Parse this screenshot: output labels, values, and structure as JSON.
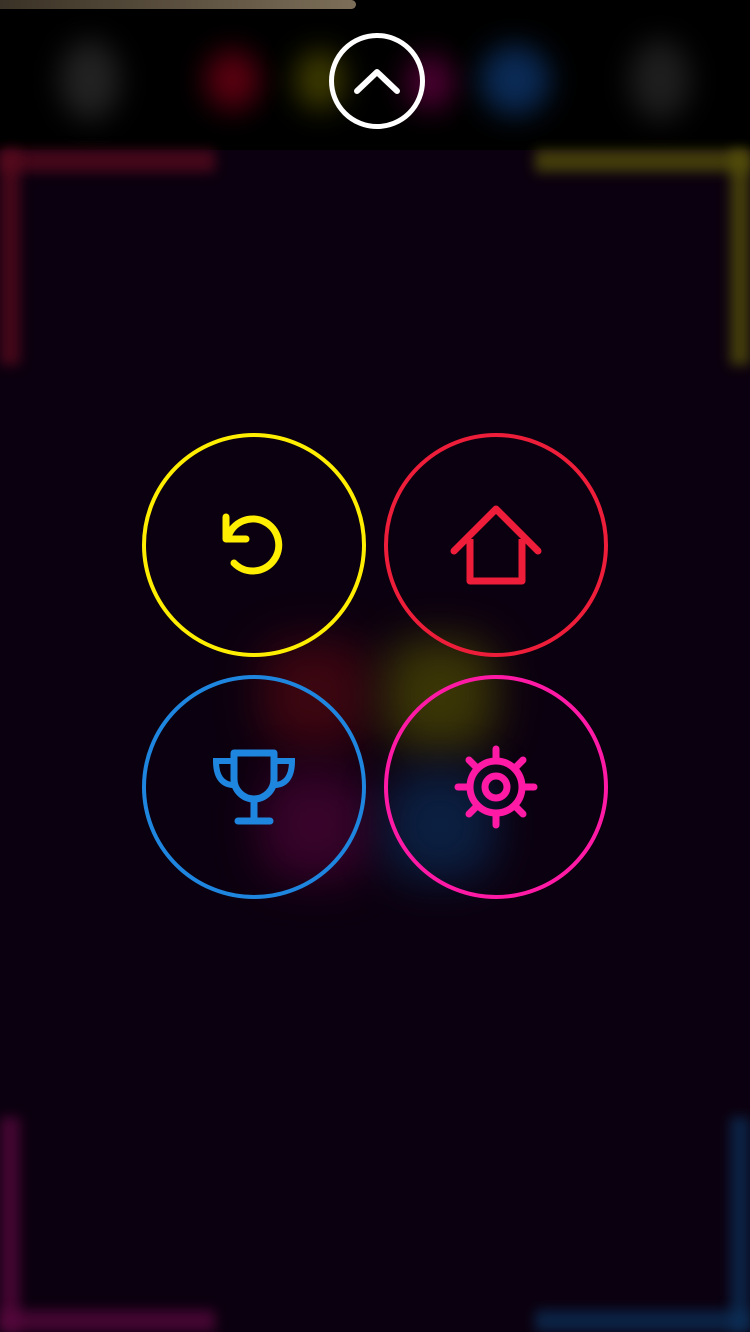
{
  "progress": {
    "fraction": 0.475,
    "color": "#7c6e58"
  },
  "colors": {
    "background": "#0b000f",
    "yellow": "#ffee00",
    "red": "#ee1e3a",
    "blue": "#1f86e0",
    "magenta": "#ff1aa6",
    "white": "#ffffff"
  },
  "header": {
    "collapse_icon": "chevron-up-icon"
  },
  "menu": {
    "buttons": [
      {
        "name": "restart",
        "icon": "restart-icon",
        "color": "#ffee00"
      },
      {
        "name": "home",
        "icon": "home-icon",
        "color": "#ee1e3a"
      },
      {
        "name": "leaderboard",
        "icon": "trophy-icon",
        "color": "#1f86e0"
      },
      {
        "name": "settings",
        "icon": "gear-icon",
        "color": "#ff1aa6"
      }
    ]
  }
}
